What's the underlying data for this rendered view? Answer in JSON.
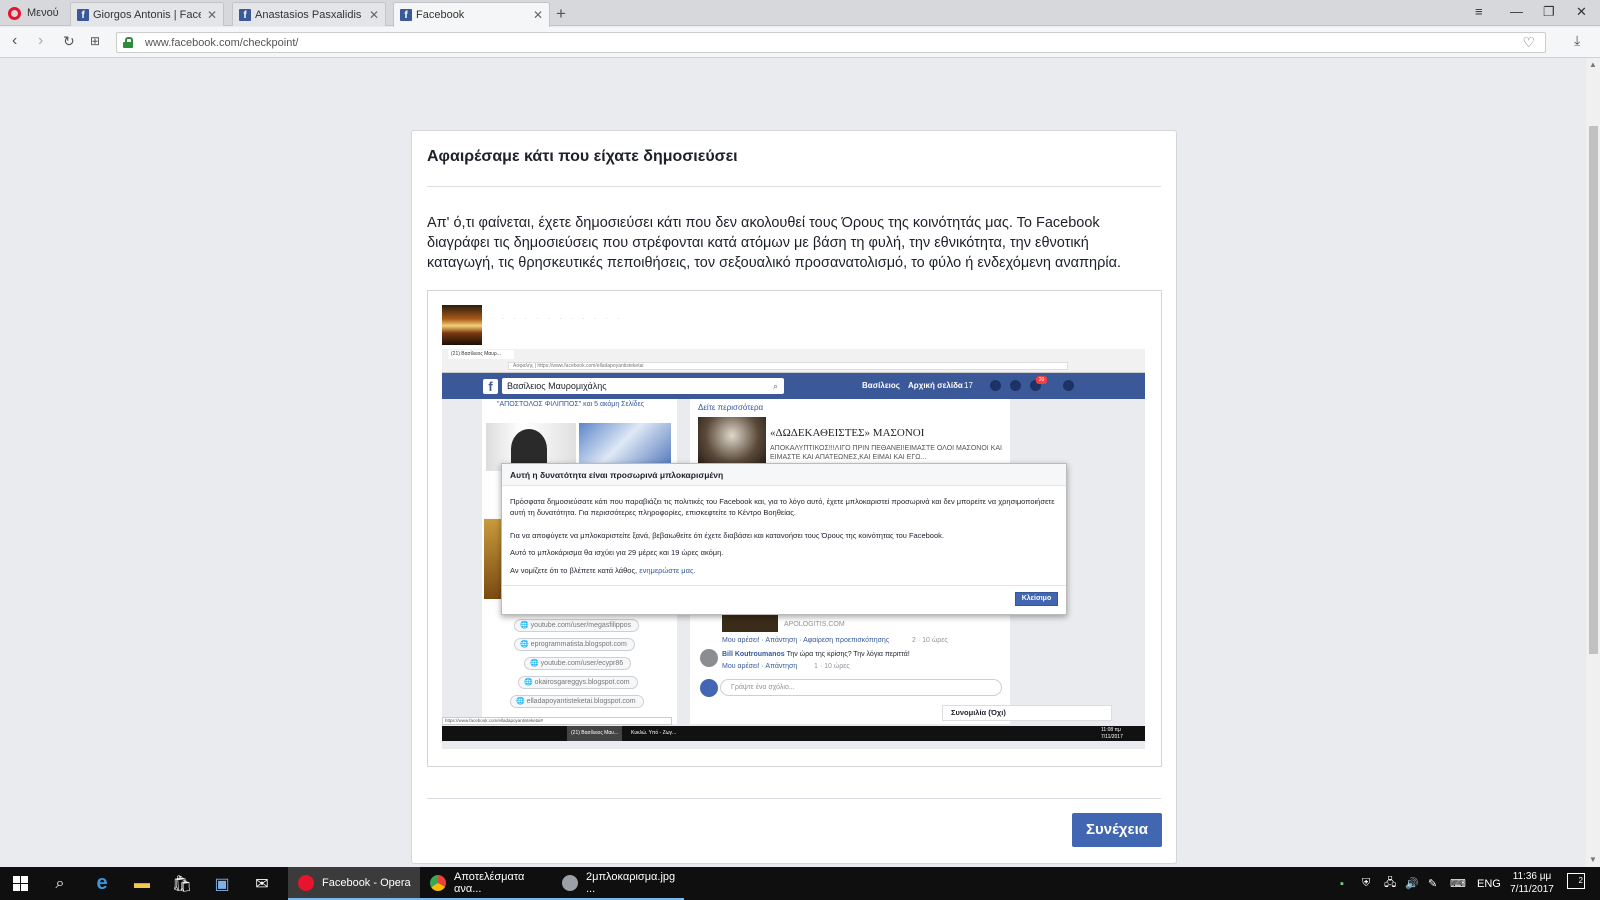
{
  "browser": {
    "menu_label": "Μενού",
    "tabs": [
      {
        "title": "Giorgos Antonis | Facebook",
        "active": false
      },
      {
        "title": "Anastasios Pasxalidis | Facebook",
        "active": false
      },
      {
        "title": "Facebook",
        "active": true
      }
    ],
    "url_host": "www.facebook.com",
    "url_path": "/checkpoint/"
  },
  "card": {
    "title": "Αφαιρέσαμε κάτι που είχατε δημοσιεύσει",
    "description": "Απ' ό,τι φαίνεται, έχετε δημοσιεύσει κάτι που δεν ακολουθεί τους Όρους της κοινότητάς μας. Το Facebook διαγράφει τις δημοσιεύσεις που στρέφονται κατά ατόμων με βάση τη φυλή, την εθνικότητα, την εθνοτική καταγωγή, τις θρησκευτικές πεποιθήσεις, τον σεξουαλικό προσανατολισμό, το φύλο ή ενδεχόμενη αναπηρία.",
    "continue_label": "Συνέχεια"
  },
  "embedded": {
    "blurred_name": "· · · · · · · · · · · ·",
    "inner_tab": "(21) Βασίλειος Μαυρ...",
    "inner_url": "Ασφαλής | https://www.facebook.com/elladapoyantisteketai",
    "search_value": "Βασίλειος Μαυρομιχάλης",
    "nav_name": "Βασίλειος",
    "nav_home": "Αρχική σελίδα",
    "nav_home_count": "17",
    "notif_count": "20",
    "liked_pages": "\"ΑΠΟΣΤΟΛΟΣ ΦΙΛΙΠΠΟΣ\" και 5 ακόμη Σελίδες",
    "see_more": "Δείτε περισσότερα",
    "article_title": "«ΔΩΔΕΚΑΘΕΙΣΤΕΣ» ΜΑΣΟΝΟΙ",
    "article_sub": "ΑΠΟΚΑΛΥΠΤΙΚΟΣ!!!ΛΙΓΟ ΠΡΙΝ ΠΕΘΑΝΕΙ!ΕΙΜΑΣΤΕ ΟΛΟΙ ΜΑΣΟΝΟΙ ΚΑΙ ΕΙΜΑΣΤΕ ΚΑΙ ΑΠΑΤΕΩΝΕΣ,ΚΑΙ ΕΙΜΑΙ ΚΑΙ ΕΓΩ...",
    "modal": {
      "title": "Αυτή η δυνατότητα είναι προσωρινά μπλοκαρισμένη",
      "p1": "Πρόσφατα δημοσιεύσατε κάτι που παραβιάζει τις πολιτικές του Facebook και, για το λόγο αυτό, έχετε μπλοκαριστεί προσωρινά και δεν μπορείτε να χρησιμοποιήσετε αυτή τη δυνατότητα. Για περισσότερες πληροφορίες, επισκεφτείτε το Κέντρο Βοηθείας.",
      "p2": "Για να αποφύγετε να μπλοκαριστείτε ξανά, βεβαιωθείτε ότι έχετε διαβάσει και κατανοήσει τους Όρους της κοινότητας του Facebook.",
      "p3": "Αυτό το μπλοκάρισμα θα ισχύει για 29 μέρες και 19 ώρες ακόμη.",
      "p4_prefix": "Αν νομίζετε ότι το βλέπετε κατά λάθος,",
      "p4_link": "ενημερώστε μας.",
      "close_label": "Κλείσιμο"
    },
    "links": [
      "youtube.com/user/megasfilippos",
      "eprogrammatista.blogspot.com",
      "youtube.com/user/ecypr86",
      "okairosgareggys.blogspot.com",
      "elladapoyantisteketai.blogspot.com"
    ],
    "apologitis": "APOLOGITIS.COM",
    "actions1": "Μου αρέσει! · Απάντηση · Αφαίρεση προεπισκόπησης",
    "actions1_meta": "2 · 10 ώρες",
    "commenter": "Bill Koutroumanos",
    "comment_text": "Την ώρα της κρίσης? Την λόγια περιττά!",
    "actions2": "Μου αρέσει! · Απάντηση",
    "actions2_meta": "1 · 10 ώρες",
    "write_comment": "Γράψτε ένα σχόλιο...",
    "chat_label": "Συνομιλία (Όχι)",
    "status_url": "https://www.facebook.com/elladapoyantisteketai#",
    "task1": "(21) Βασίλειος Μαυ...",
    "task2": "Κυκλώ. Υπό - Ζωγ...",
    "inner_clock": "11:08 πμ",
    "inner_date": "7/11/2017"
  },
  "taskbar": {
    "apps": [
      {
        "label": "Facebook - Opera",
        "color": "#e8142d",
        "active": true
      },
      {
        "label": "Αποτελέσματα ανα...",
        "color": "#4285f4",
        "active": false
      },
      {
        "label": "2μπλοκαρισμα.jpg ...",
        "color": "#9aa0a6",
        "active": false
      }
    ],
    "lang": "ENG",
    "time": "11:36 μμ",
    "date": "7/11/2017",
    "notif_count": "2"
  }
}
